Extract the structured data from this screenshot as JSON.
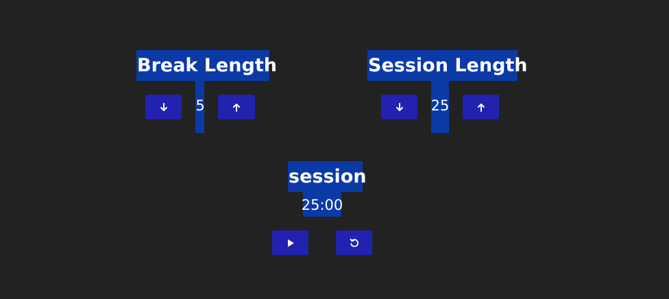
{
  "break": {
    "title": "Break Length",
    "value": "5",
    "decrement_icon": "arrow-down-icon",
    "increment_icon": "arrow-up-icon"
  },
  "session": {
    "title": "Session Length",
    "value": "25",
    "decrement_icon": "arrow-down-icon",
    "increment_icon": "arrow-up-icon"
  },
  "timer": {
    "label": "session",
    "time": "25:00",
    "play_icon": "play-icon",
    "reset_icon": "reset-icon"
  },
  "colors": {
    "background": "#222222",
    "label_bg": "#0b3aa6",
    "button_bg": "#2222b0",
    "text": "#ffffff"
  }
}
